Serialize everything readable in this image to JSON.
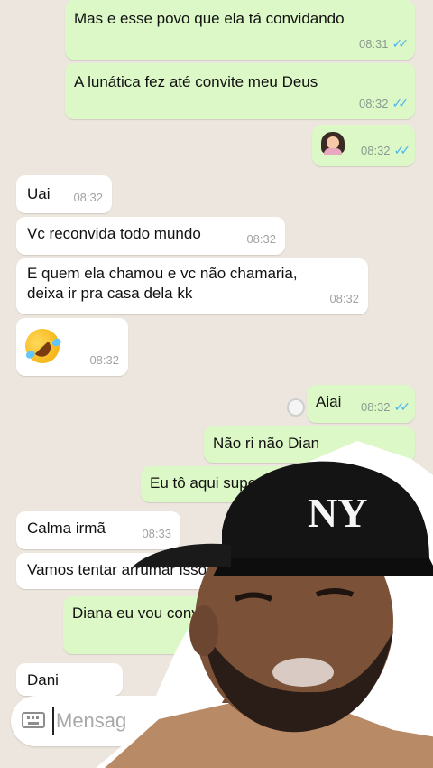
{
  "messages": [
    {
      "dir": "out",
      "text": "Mas e esse povo que ela tá convidando",
      "time": "08:31",
      "read": true
    },
    {
      "dir": "out",
      "text": "A lunática fez até convite meu Deus",
      "time": "08:32",
      "read": true
    },
    {
      "dir": "out",
      "emoji": "woman-facepalming",
      "time": "08:32",
      "read": true
    },
    {
      "dir": "in",
      "text": "Uai",
      "time": "08:32"
    },
    {
      "dir": "in",
      "text": "Vc reconvida todo mundo",
      "time": "08:32"
    },
    {
      "dir": "in",
      "text_lines": [
        "E quem ela chamou e vc não chamaria,",
        "deixa ir pra casa dela kk"
      ],
      "time": "08:32"
    },
    {
      "dir": "in",
      "emoji": "rolling-on-floor-laughing",
      "time": "08:32"
    },
    {
      "dir": "out",
      "text": "Aiai",
      "time": "08:32",
      "read": true
    },
    {
      "dir": "out",
      "text": "Não ri não Dian"
    },
    {
      "dir": "out",
      "text": "Eu tô aqui supe"
    },
    {
      "dir": "in",
      "text": "Calma irmã",
      "time": "08:33"
    },
    {
      "dir": "in",
      "text": "Vamos tentar arrumar isso"
    },
    {
      "dir": "out",
      "text": "Diana eu vou convers"
    },
    {
      "dir": "in",
      "text": "Dani"
    }
  ],
  "composer": {
    "placeholder": "Mensag",
    "icon": "keyboard-icon"
  },
  "colors": {
    "background": "#ece6de",
    "outgoing_bubble": "#dcf8c6",
    "incoming_bubble": "#ffffff",
    "read_ticks": "#4fb6ec"
  },
  "overlay": {
    "subject": "man-in-black-cap",
    "cap_logo_text": "NY"
  }
}
